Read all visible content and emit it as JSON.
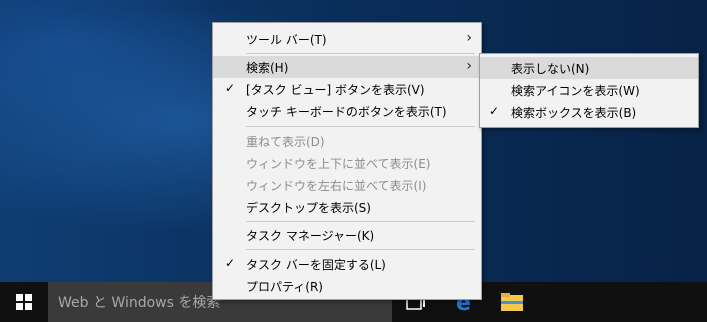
{
  "context_menu": {
    "items": [
      {
        "label": "ツール バー(T)",
        "arrow": "›"
      },
      {
        "label": "検索(H)",
        "arrow": "›"
      },
      {
        "label": "[タスク ビュー] ボタンを表示(V)",
        "check": "✓"
      },
      {
        "label": "タッチ キーボードのボタンを表示(T)"
      },
      {
        "label": "重ねて表示(D)"
      },
      {
        "label": "ウィンドウを上下に並べて表示(E)"
      },
      {
        "label": "ウィンドウを左右に並べて表示(I)"
      },
      {
        "label": "デスクトップを表示(S)"
      },
      {
        "label": "タスク マネージャー(K)"
      },
      {
        "label": "タスク バーを固定する(L)",
        "check": "✓"
      },
      {
        "label": "プロパティ(R)"
      }
    ]
  },
  "search_submenu": {
    "items": [
      {
        "label": "表示しない(N)"
      },
      {
        "label": "検索アイコンを表示(W)"
      },
      {
        "label": "検索ボックスを表示(B)",
        "check": "✓"
      }
    ]
  },
  "taskbar": {
    "search_placeholder": "Web と Windows を検索"
  },
  "colors": {
    "menu_bg": "#f2f2f2",
    "highlight": "#dadada",
    "taskbar": "#101010",
    "edge_blue": "#1e7ad6",
    "folder_yellow": "#f2c94c"
  }
}
